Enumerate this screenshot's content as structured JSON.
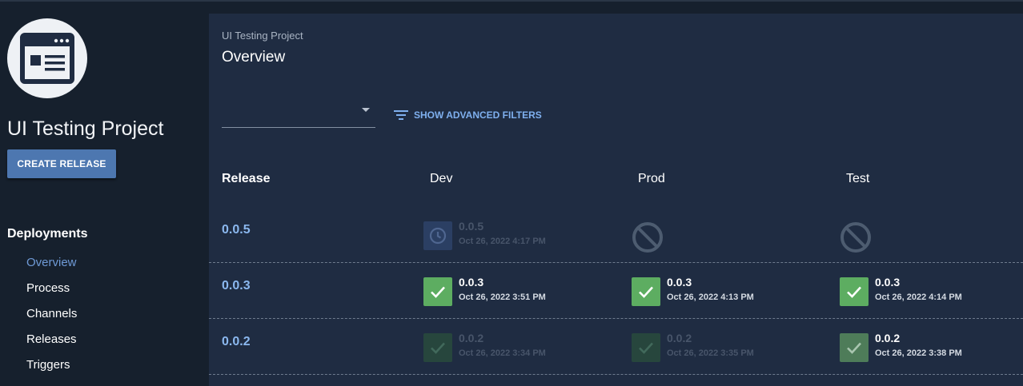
{
  "sidebar": {
    "project_title": "UI Testing Project",
    "create_release_label": "CREATE RELEASE",
    "nav_heading": "Deployments",
    "nav_items": [
      {
        "label": "Overview",
        "active": true
      },
      {
        "label": "Process",
        "active": false
      },
      {
        "label": "Channels",
        "active": false
      },
      {
        "label": "Releases",
        "active": false
      },
      {
        "label": "Triggers",
        "active": false
      }
    ]
  },
  "main": {
    "breadcrumb": "UI Testing Project",
    "title": "Overview",
    "channel_select_value": "",
    "advanced_filters_label": "SHOW ADVANCED FILTERS",
    "columns": [
      "Release",
      "Dev",
      "Prod",
      "Test"
    ],
    "rows": [
      {
        "version": "0.0.5",
        "cells": [
          {
            "status": "queued",
            "version": "0.0.5",
            "date": "Oct 26, 2022 4:17 PM"
          },
          {
            "status": "none",
            "version": "",
            "date": ""
          },
          {
            "status": "none",
            "version": "",
            "date": ""
          }
        ]
      },
      {
        "version": "0.0.3",
        "cells": [
          {
            "status": "success",
            "version": "0.0.3",
            "date": "Oct 26, 2022 3:51 PM"
          },
          {
            "status": "success",
            "version": "0.0.3",
            "date": "Oct 26, 2022 4:13 PM"
          },
          {
            "status": "success",
            "version": "0.0.3",
            "date": "Oct 26, 2022 4:14 PM"
          }
        ]
      },
      {
        "version": "0.0.2",
        "cells": [
          {
            "status": "success-previous",
            "version": "0.0.2",
            "date": "Oct 26, 2022 3:34 PM"
          },
          {
            "status": "success-previous",
            "version": "0.0.2",
            "date": "Oct 26, 2022 3:35 PM"
          },
          {
            "status": "success-previous-current",
            "version": "0.0.2",
            "date": "Oct 26, 2022 3:38 PM"
          }
        ]
      }
    ]
  },
  "colors": {
    "accent": "#4d77b0",
    "link": "#8bb8ef",
    "success": "#5dad61",
    "panel": "#1f2c42",
    "background": "#16202d"
  },
  "icons": {
    "logo": "browser-window-icon",
    "filter": "filter-lines-icon",
    "queued": "clock-icon",
    "success": "check-icon",
    "none": "prohibited-icon"
  }
}
